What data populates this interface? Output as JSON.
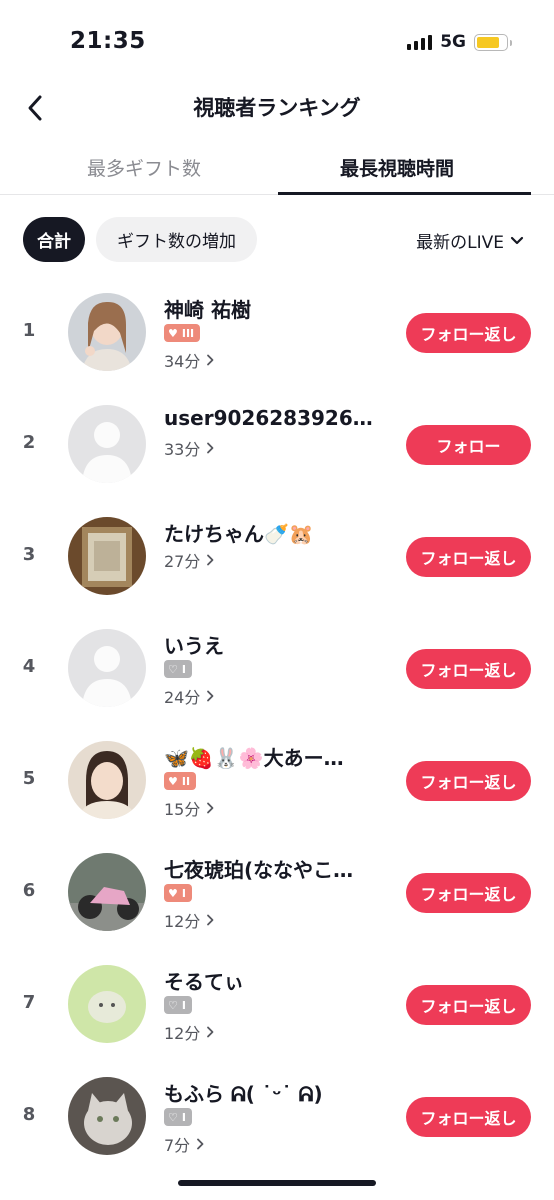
{
  "status_bar": {
    "time": "21:35",
    "network": "5G"
  },
  "header": {
    "title": "視聴者ランキング"
  },
  "tabs": [
    {
      "label": "最多ギフト数"
    },
    {
      "label": "最長視聴時間"
    }
  ],
  "filters": {
    "chips": [
      {
        "label": "合計"
      },
      {
        "label": "ギフト数の増加"
      }
    ],
    "sort_label": "最新のLIVE"
  },
  "ranking": [
    {
      "rank": "1",
      "name": "神崎 祐樹",
      "badge": "III",
      "watch_time": "34分",
      "button": "フォロー返し"
    },
    {
      "rank": "2",
      "name": "user90262839267…",
      "watch_time": "33分",
      "button": "フォロー"
    },
    {
      "rank": "3",
      "name": "たけちゃん🍼🐹",
      "watch_time": "27分",
      "button": "フォロー返し"
    },
    {
      "rank": "4",
      "name": "いうえ",
      "badge": "I",
      "watch_time": "24分",
      "button": "フォロー返し"
    },
    {
      "rank": "5",
      "name": "🦋🍓🐰🌸大あー…",
      "badge": "II",
      "watch_time": "15分",
      "button": "フォロー返し"
    },
    {
      "rank": "6",
      "name": "七夜琥珀(ななやこ…",
      "badge": "I",
      "watch_time": "12分",
      "button": "フォロー返し"
    },
    {
      "rank": "7",
      "name": "そるてぃ",
      "badge": "I",
      "watch_time": "12分",
      "button": "フォロー返し"
    },
    {
      "rank": "8",
      "name": "もふら ᕱ( ˙ᵕ˙ ᕱ)",
      "badge": "I",
      "watch_time": "7分",
      "button": "フォロー返し"
    }
  ],
  "colors": {
    "accent": "#ee3b57",
    "text": "#161823",
    "muted": "#8a8b91",
    "badge_fan": "#ee8a7a",
    "badge_gray": "#b3b3b5"
  },
  "icons": {
    "back": "chevron-left-icon",
    "dropdown": "chevron-down-icon",
    "time_arrow": "chevron-right-icon",
    "badge": "heart-icon"
  }
}
